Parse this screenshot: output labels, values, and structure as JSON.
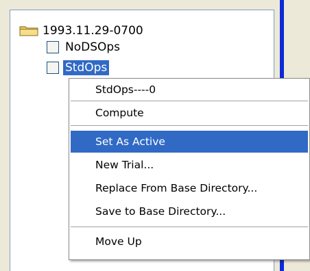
{
  "tree": {
    "root_label": "1993.11.29-0700",
    "children": [
      {
        "label": "NoDSOps",
        "selected": false
      },
      {
        "label": "StdOps",
        "selected": true
      }
    ]
  },
  "context_menu": {
    "header": "StdOps----0",
    "items": [
      {
        "label": "Compute"
      },
      {
        "label": "Set As Active",
        "highlighted": true
      },
      {
        "label": "New Trial..."
      },
      {
        "label": "Replace From Base Directory..."
      },
      {
        "label": "Save to Base Directory..."
      },
      {
        "label": "Move Up"
      }
    ]
  },
  "colors": {
    "selection": "#316ac5",
    "window_edge": "#0c2bd6"
  },
  "icons": {
    "root": "folder-open-icon",
    "child": "checkbox-icon"
  }
}
